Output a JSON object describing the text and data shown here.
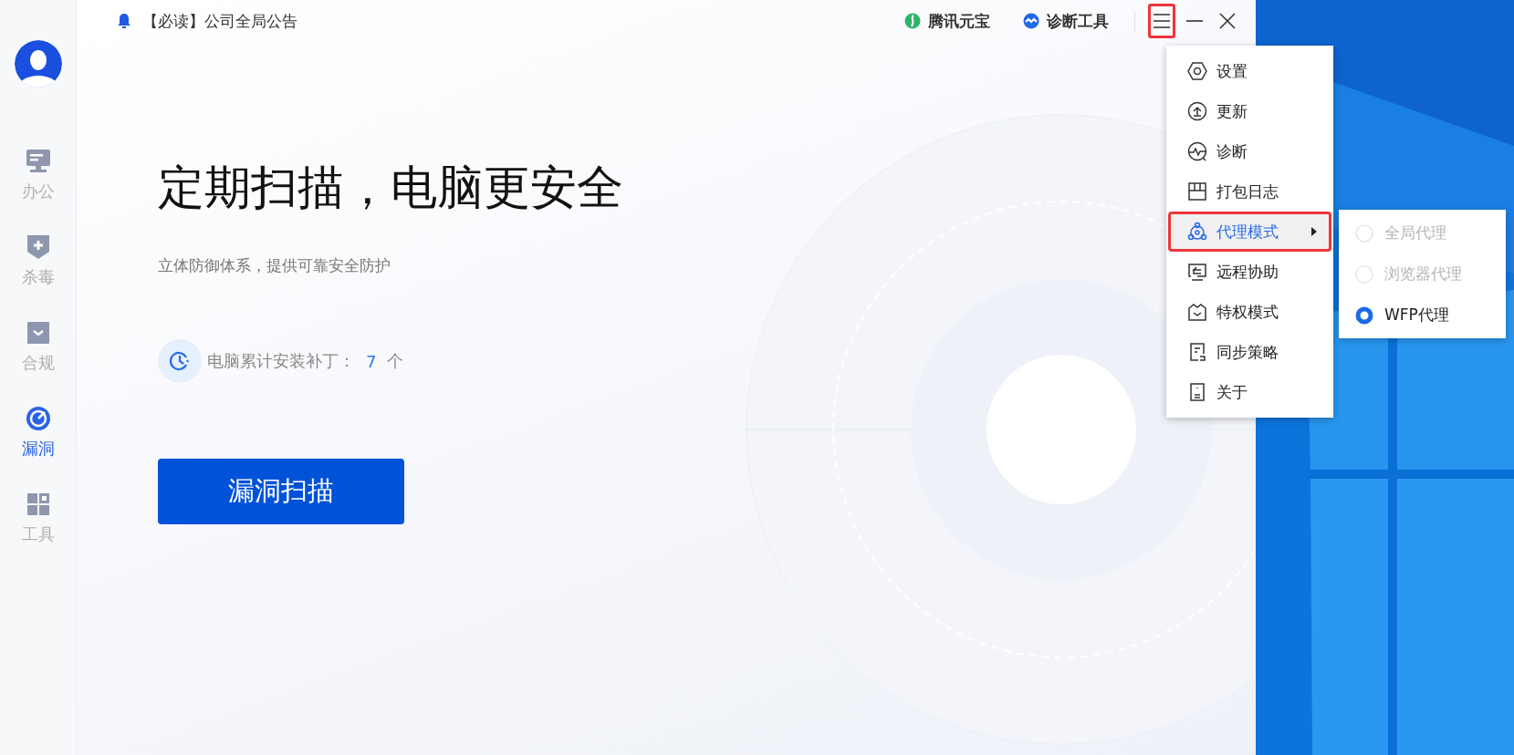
{
  "sidebar": {
    "items": [
      {
        "label": "办公",
        "kind": "monitor",
        "selected": false
      },
      {
        "label": "杀毒",
        "kind": "shield",
        "selected": false
      },
      {
        "label": "合规",
        "kind": "check",
        "selected": false
      },
      {
        "label": "漏洞",
        "kind": "radar",
        "selected": true
      },
      {
        "label": "工具",
        "kind": "grid",
        "selected": false
      }
    ]
  },
  "notice": "【必读】公司全局公告",
  "top_links": [
    {
      "label": "腾讯元宝",
      "kind": "yuanbao"
    },
    {
      "label": "诊断工具",
      "kind": "diagnose"
    }
  ],
  "menu_button": {
    "highlighted": true
  },
  "hero": {
    "title": "定期扫描，电脑更安全",
    "subtitle": "立体防御体系，提供可靠安全防护",
    "patch_label": "电脑累计安装补丁：",
    "patch_count": "7",
    "patch_unit": "个",
    "scan_button": "漏洞扫描"
  },
  "menu": {
    "items": [
      {
        "label": "设置",
        "kind": "settings",
        "selected": false,
        "highlighted": false,
        "submenu": false
      },
      {
        "label": "更新",
        "kind": "update",
        "selected": false,
        "highlighted": false,
        "submenu": false
      },
      {
        "label": "诊断",
        "kind": "diagnose",
        "selected": false,
        "highlighted": false,
        "submenu": false
      },
      {
        "label": "打包日志",
        "kind": "log",
        "selected": false,
        "highlighted": false,
        "submenu": false
      },
      {
        "label": "代理模式",
        "kind": "proxy",
        "selected": true,
        "highlighted": true,
        "submenu": true
      },
      {
        "label": "远程协助",
        "kind": "remote",
        "selected": false,
        "highlighted": false,
        "submenu": false
      },
      {
        "label": "特权模式",
        "kind": "privilege",
        "selected": false,
        "highlighted": false,
        "submenu": false
      },
      {
        "label": "同步策略",
        "kind": "sync",
        "selected": false,
        "highlighted": false,
        "submenu": false
      },
      {
        "label": "关于",
        "kind": "about",
        "selected": false,
        "highlighted": false,
        "submenu": false
      }
    ]
  },
  "submenu": {
    "items": [
      {
        "label": "全局代理",
        "selected": false,
        "disabled": true
      },
      {
        "label": "浏览器代理",
        "selected": false,
        "disabled": true
      },
      {
        "label": "WFP代理",
        "selected": true,
        "disabled": false
      }
    ]
  }
}
